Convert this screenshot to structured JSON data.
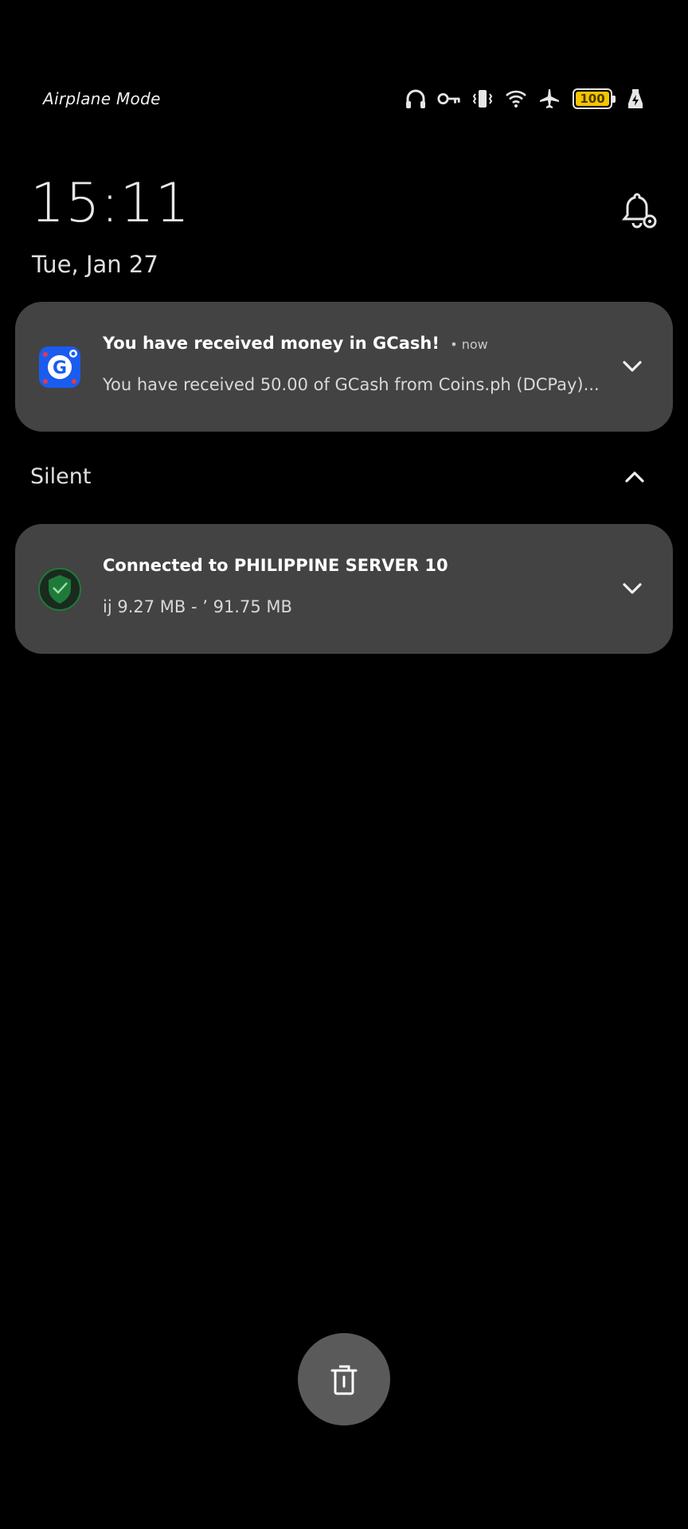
{
  "status_bar": {
    "carrier_text": "Airplane Mode",
    "icons": [
      "headphones-icon",
      "vpn-key-icon",
      "vibrate-icon",
      "wifi-icon",
      "airplane-icon",
      "battery-icon",
      "charging-icon"
    ],
    "battery_level": "100",
    "battery_color": "#f5c400"
  },
  "lockscreen": {
    "time": "15:11",
    "date": "Tue, Jan 27"
  },
  "notifications": [
    {
      "app_icon": "gcash-icon",
      "title": "You have received money in GCash!",
      "time": "• now",
      "text": "You have received 50.00 of GCash from Coins.ph (DCPay)..."
    }
  ],
  "silent_section": {
    "label": "Silent",
    "notifications": [
      {
        "app_icon": "vpn-shield-icon",
        "title": "Connected to PHILIPPINE SERVER 10",
        "text": "ij 9.27 MB - ’ 91.75 MB"
      }
    ]
  },
  "colors": {
    "background": "#000000",
    "card": "#434343",
    "fab": "#5a5a5a",
    "gcash_blue": "#1a5cf0",
    "vpn_green": "#1f7a3a"
  }
}
